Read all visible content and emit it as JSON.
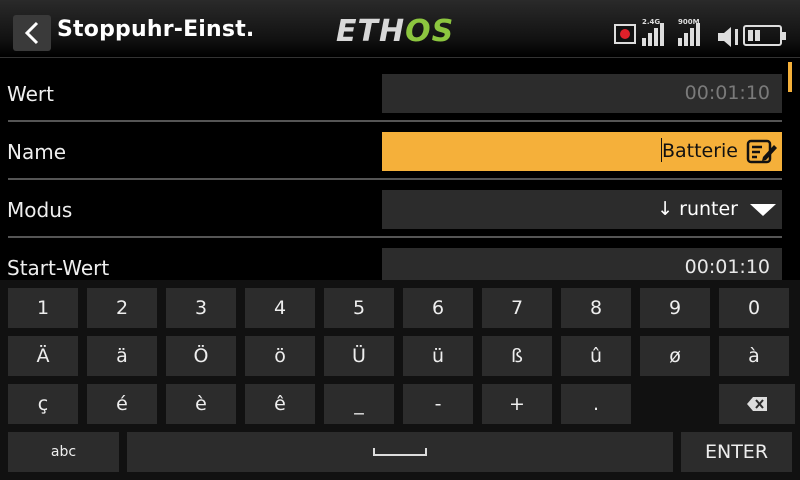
{
  "header": {
    "title": "Stoppuhr-Einst.",
    "logo_part1": "ETH",
    "logo_part2": "OS",
    "rf_label_1": "2.4G",
    "rf_label_2": "900M"
  },
  "form": {
    "rows": [
      {
        "label": "Wert",
        "value": "00:01:10"
      },
      {
        "label": "Name",
        "value": "Batterie"
      },
      {
        "label": "Modus",
        "value": "↓ runter"
      },
      {
        "label": "Start-Wert",
        "value": "00:01:10"
      }
    ]
  },
  "keyboard": {
    "row1": [
      "1",
      "2",
      "3",
      "4",
      "5",
      "6",
      "7",
      "8",
      "9",
      "0"
    ],
    "row2": [
      "Ä",
      "ä",
      "Ö",
      "ö",
      "Ü",
      "ü",
      "ß",
      "û",
      "ø",
      "à"
    ],
    "row3": [
      "ç",
      "é",
      "è",
      "ê",
      "_",
      "-",
      "+",
      "."
    ],
    "abc": "abc",
    "enter": "ENTER"
  },
  "colors": {
    "accent": "#f5b03a",
    "logo_green": "#8cc63f",
    "field_bg": "#2c2c2c"
  }
}
